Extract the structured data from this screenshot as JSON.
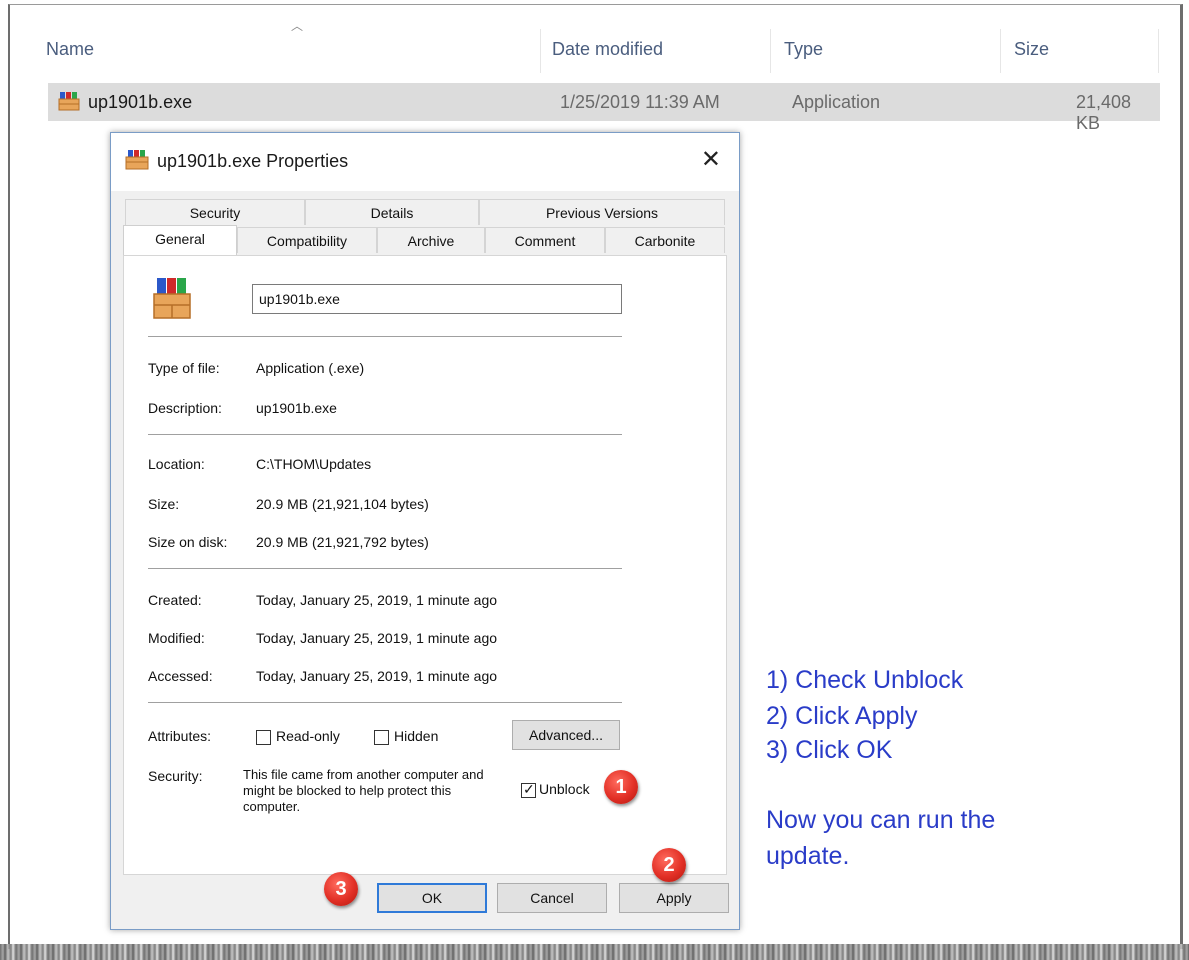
{
  "explorer": {
    "columns": {
      "name": "Name",
      "date": "Date modified",
      "type": "Type",
      "size": "Size"
    },
    "file": {
      "name": "up1901b.exe",
      "date": "1/25/2019 11:39 AM",
      "type": "Application",
      "size": "21,408 KB"
    }
  },
  "dialog": {
    "title": "up1901b.exe Properties",
    "close": "✕",
    "tabs_back": [
      "Security",
      "Details",
      "Previous Versions"
    ],
    "tabs_front": [
      "General",
      "Compatibility",
      "Archive",
      "Comment",
      "Carbonite"
    ],
    "active_tab": "General",
    "filename": "up1901b.exe",
    "fields": {
      "type_label": "Type of file:",
      "type_value": "Application (.exe)",
      "desc_label": "Description:",
      "desc_value": "up1901b.exe",
      "loc_label": "Location:",
      "loc_value": "C:\\THOM\\Updates",
      "size_label": "Size:",
      "size_value": "20.9 MB (21,921,104 bytes)",
      "disk_label": "Size on disk:",
      "disk_value": "20.9 MB (21,921,792 bytes)",
      "created_label": "Created:",
      "created_value": "Today, January 25, 2019, 1 minute ago",
      "modified_label": "Modified:",
      "modified_value": "Today, January 25, 2019, 1 minute ago",
      "accessed_label": "Accessed:",
      "accessed_value": "Today, January 25, 2019, 1 minute ago",
      "attributes_label": "Attributes:",
      "security_label": "Security:"
    },
    "attributes": {
      "readonly": "Read-only",
      "hidden": "Hidden",
      "readonly_checked": false,
      "hidden_checked": false
    },
    "advanced_button": "Advanced...",
    "security_text": "This file came from another computer and might be blocked to help protect this computer.",
    "unblock": {
      "label": "Unblock",
      "checked": true
    },
    "buttons": {
      "ok": "OK",
      "cancel": "Cancel",
      "apply": "Apply"
    }
  },
  "badges": [
    "1",
    "2",
    "3"
  ],
  "instructions": {
    "step1": "1) Check Unblock",
    "step2": "2) Click Apply",
    "step3": "3) Click OK",
    "note_line1": "Now you can run the",
    "note_line2": "update."
  },
  "colors": {
    "badge": "#e23026",
    "instruction_text": "#2a3cc8",
    "dialog_border": "#7a9cc6"
  }
}
